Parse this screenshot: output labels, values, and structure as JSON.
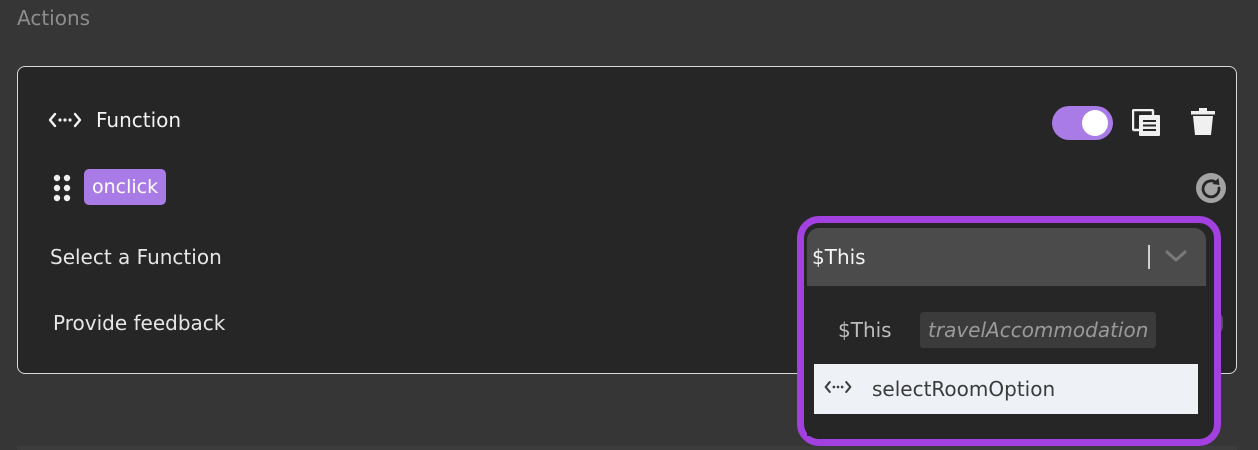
{
  "section": {
    "title": "Actions"
  },
  "action": {
    "type_label": "Function",
    "event_tag": "onclick",
    "enabled": true,
    "select_label": "Select a Function",
    "feedback_label": "Provide feedback"
  },
  "function_select": {
    "value": "$This",
    "group_label": "$This",
    "group_context": "travelAccommodation",
    "options": [
      {
        "label": "selectRoomOption",
        "icon": "code-icon"
      }
    ]
  },
  "colors": {
    "accent": "#a97be6",
    "highlight": "#a341e0",
    "card_bg": "#262626",
    "page_bg": "#363636"
  },
  "icons": [
    "code-icon",
    "copy-icon",
    "trash-icon",
    "drag-handle-icon",
    "reset-icon",
    "chevron-down-icon"
  ]
}
